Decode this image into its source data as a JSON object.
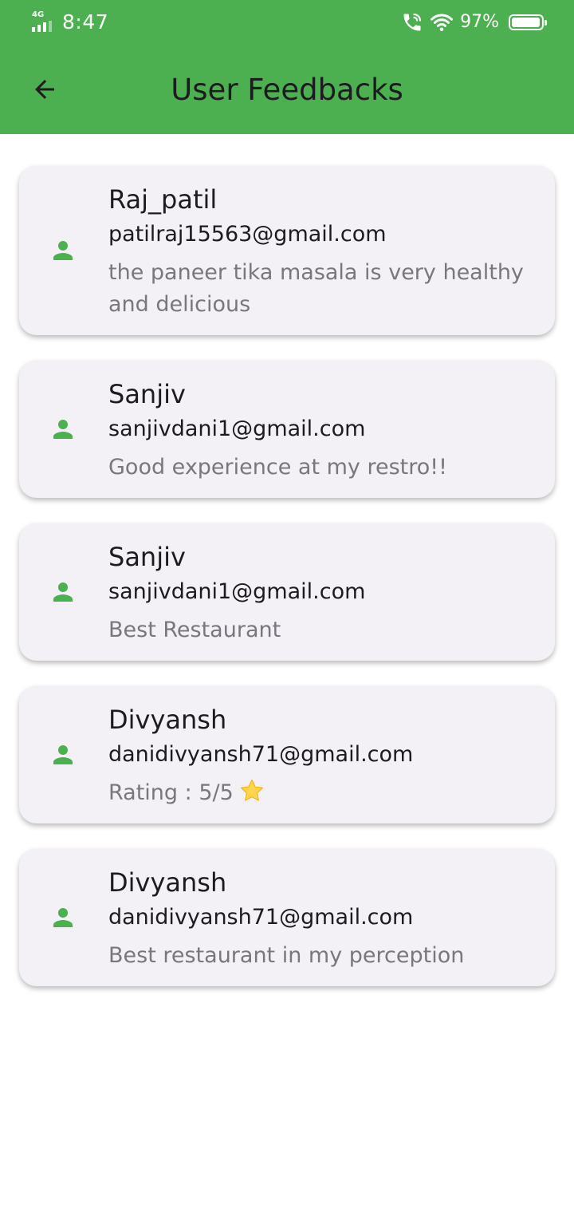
{
  "status_bar": {
    "network": "4G",
    "time": "8:47",
    "battery_percent": "97%",
    "battery_level": 0.97,
    "icons": [
      "signal-icon",
      "wifi-calling-icon",
      "wifi-icon",
      "battery-icon"
    ]
  },
  "app_bar": {
    "title": "User Feedbacks",
    "back_icon": "arrow-back-icon",
    "background_color": "#4caf50"
  },
  "feedbacks": [
    {
      "name": "Raj_patil",
      "email": "patilraj15563@gmail.com",
      "message": "the paneer tika masala is very healthy and delicious"
    },
    {
      "name": "Sanjiv",
      "email": "sanjivdani1@gmail.com",
      "message": "Good experience at my restro!!"
    },
    {
      "name": "Sanjiv",
      "email": "sanjivdani1@gmail.com",
      "message": "Best Restaurant"
    },
    {
      "name": "Divyansh",
      "email": "danidivyansh71@gmail.com",
      "message": "Rating : 5/5",
      "trailing_icon": "star-icon"
    },
    {
      "name": "Divyansh",
      "email": "danidivyansh71@gmail.com",
      "message": "Best restaurant in my perception"
    }
  ],
  "colors": {
    "accent": "#4caf50",
    "card_background": "#f3f0f6",
    "message_text": "#79767d",
    "star": "#ffd54f"
  }
}
